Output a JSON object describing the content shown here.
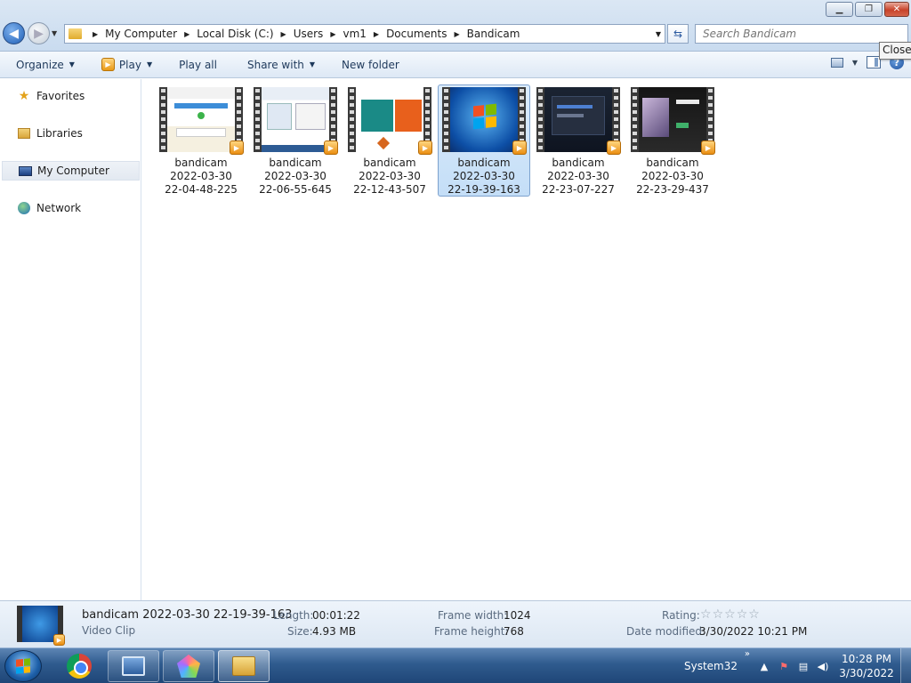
{
  "window": {
    "minimize": "▁",
    "restore": "❐",
    "close": "✕",
    "tooltip": "Close"
  },
  "address": {
    "crumbs": [
      "My Computer",
      "Local Disk (C:)",
      "Users",
      "vm1",
      "Documents",
      "Bandicam"
    ],
    "search_placeholder": "Search Bandicam"
  },
  "toolbar": {
    "organize": "Organize",
    "play": "Play",
    "play_all": "Play all",
    "share_with": "Share with",
    "new_folder": "New folder"
  },
  "sidebar": {
    "items": [
      {
        "label": "Favorites",
        "icon": "star-icon"
      },
      {
        "label": "Libraries",
        "icon": "libraries-icon"
      },
      {
        "label": "My Computer",
        "icon": "computer-icon",
        "selected": true
      },
      {
        "label": "Network",
        "icon": "network-icon"
      }
    ]
  },
  "files": [
    {
      "name": "bandicam",
      "date": "2022-03-30",
      "time": "22-04-48-225"
    },
    {
      "name": "bandicam",
      "date": "2022-03-30",
      "time": "22-06-55-645"
    },
    {
      "name": "bandicam",
      "date": "2022-03-30",
      "time": "22-12-43-507"
    },
    {
      "name": "bandicam",
      "date": "2022-03-30",
      "time": "22-19-39-163",
      "selected": true
    },
    {
      "name": "bandicam",
      "date": "2022-03-30",
      "time": "22-23-07-227"
    },
    {
      "name": "bandicam",
      "date": "2022-03-30",
      "time": "22-23-29-437"
    }
  ],
  "details": {
    "filename": "bandicam 2022-03-30 22-19-39-163",
    "type": "Video Clip",
    "length_label": "Length:",
    "length": "00:01:22",
    "size_label": "Size:",
    "size": "4.93 MB",
    "frame_width_label": "Frame width:",
    "frame_width": "1024",
    "frame_height_label": "Frame height:",
    "frame_height": "768",
    "rating_label": "Rating:",
    "rating_stars": 0,
    "modified_label": "Date modified:",
    "modified": "3/30/2022 10:21 PM"
  },
  "taskbar": {
    "system32": "System32",
    "time": "10:28 PM",
    "date": "3/30/2022"
  },
  "colors": {
    "accent": "#1f5fb6",
    "selection": "#c4def7",
    "taskbar": "#2f5b8e"
  }
}
